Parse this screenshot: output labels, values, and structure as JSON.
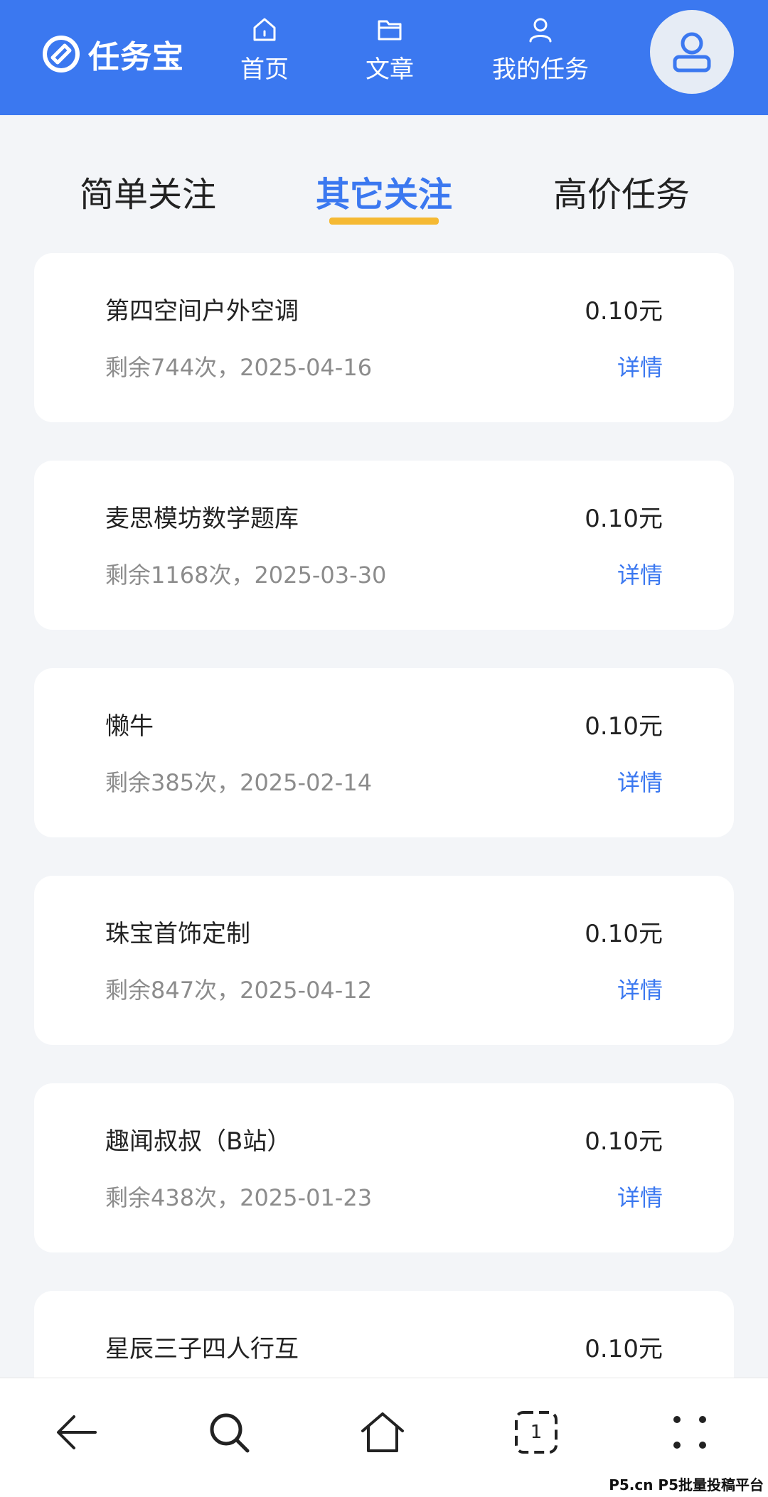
{
  "header": {
    "logo_text": "任务宝",
    "nav": [
      {
        "label": "首页",
        "icon": "home-icon"
      },
      {
        "label": "文章",
        "icon": "folder-icon"
      },
      {
        "label": "我的任务",
        "icon": "user-icon"
      }
    ],
    "avatar_icon": "avatar-user-icon"
  },
  "tabs": [
    {
      "label": "简单关注",
      "active": false
    },
    {
      "label": "其它关注",
      "active": true
    },
    {
      "label": "高价任务",
      "active": false
    }
  ],
  "tasks": [
    {
      "title": "第四空间户外空调",
      "meta": "剩余744次，2025-04-16",
      "price": "0.10元",
      "detail": "详情"
    },
    {
      "title": "麦思模坊数学题库",
      "meta": "剩余1168次，2025-03-30",
      "price": "0.10元",
      "detail": "详情"
    },
    {
      "title": "懒牛",
      "meta": "剩余385次，2025-02-14",
      "price": "0.10元",
      "detail": "详情"
    },
    {
      "title": "珠宝首饰定制",
      "meta": "剩余847次，2025-04-12",
      "price": "0.10元",
      "detail": "详情"
    },
    {
      "title": "趣闻叔叔（B站）",
      "meta": "剩余438次，2025-01-23",
      "price": "0.10元",
      "detail": "详情"
    },
    {
      "title": "星辰三子四人行互",
      "meta": "",
      "price": "0.10元",
      "detail": ""
    }
  ],
  "bottom_bar": {
    "tab_count": "1",
    "icons": [
      "back-arrow-icon",
      "search-icon",
      "home-icon",
      "tabs-icon",
      "more-icon"
    ]
  },
  "watermark": "P5.cn P5批量投稿平台",
  "colors": {
    "primary": "#3b78f0",
    "accent": "#f5b933",
    "background": "#f3f5f8"
  }
}
